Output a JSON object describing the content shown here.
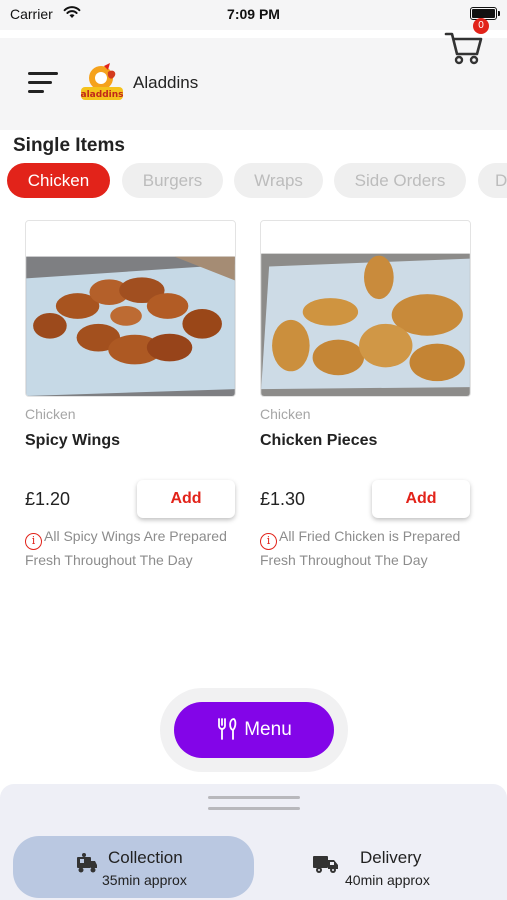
{
  "status_bar": {
    "carrier": "Carrier",
    "time": "7:09 PM"
  },
  "header": {
    "brand": "Aladdins",
    "logo_text": "aladdins",
    "cart_count": "0"
  },
  "section": {
    "title": "Single Items"
  },
  "tabs": [
    {
      "label": "Chicken",
      "active": true
    },
    {
      "label": "Burgers",
      "active": false
    },
    {
      "label": "Wraps",
      "active": false
    },
    {
      "label": "Side Orders",
      "active": false
    },
    {
      "label": "D",
      "active": false
    }
  ],
  "products": [
    {
      "category": "Chicken",
      "name": "Spicy Wings",
      "price": "£1.20",
      "add_label": "Add",
      "note": "All Spicy Wings Are Prepared Fresh Throughout The Day"
    },
    {
      "category": "Chicken",
      "name": "Chicken Pieces",
      "price": "£1.30",
      "add_label": "Add",
      "note": "All Fried Chicken is Prepared Fresh Throughout The Day"
    }
  ],
  "menu_button": {
    "label": "Menu"
  },
  "order_modes": [
    {
      "title": "Collection",
      "time": "35min approx",
      "active": true
    },
    {
      "title": "Delivery",
      "time": "40min approx",
      "active": false
    }
  ],
  "colors": {
    "accent_red": "#e2231a",
    "menu_purple": "#8305e8",
    "selected_mode": "#bac8e1"
  }
}
